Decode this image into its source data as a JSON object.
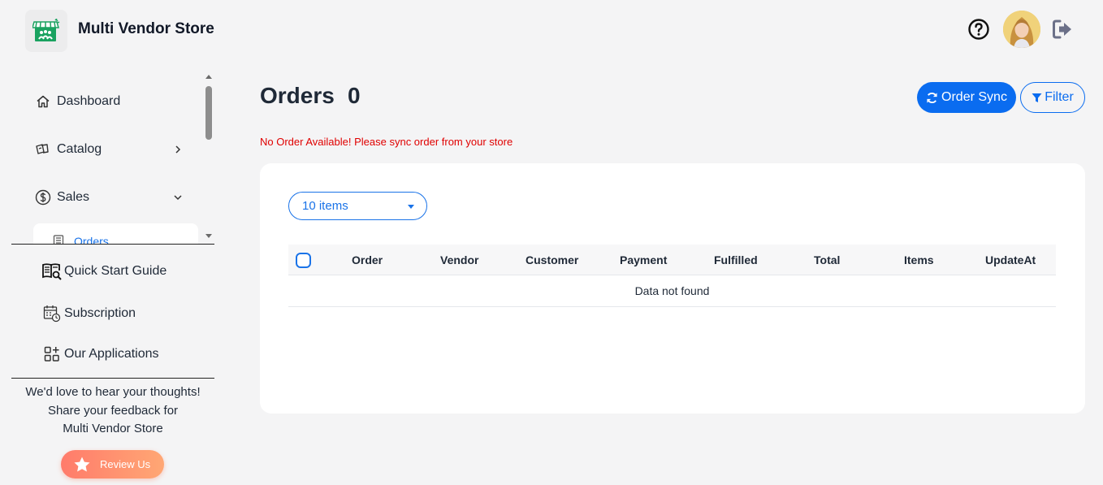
{
  "app": {
    "title": "Multi Vendor Store"
  },
  "header": {
    "help_icon": "question-circle-icon",
    "avatar": "user-avatar",
    "logout_icon": "logout-icon"
  },
  "sidebar": {
    "items": [
      {
        "label": "Dashboard",
        "icon": "home-icon"
      },
      {
        "label": "Catalog",
        "icon": "catalog-icon",
        "chevron": "chevron-right-icon"
      },
      {
        "label": "Sales",
        "icon": "dollar-circle-icon",
        "chevron": "chevron-down-icon"
      }
    ],
    "sub_items": [
      {
        "label": "Orders",
        "icon": "list-icon"
      }
    ],
    "extra": [
      {
        "label": "Quick Start Guide",
        "icon": "book-search-icon"
      },
      {
        "label": "Subscription",
        "icon": "calendar-clock-icon"
      },
      {
        "label": "Our Applications",
        "icon": "apps-grid-icon"
      }
    ],
    "feedback": {
      "line1": "We'd love to hear your thoughts!",
      "line2": "Share your feedback for",
      "line3": "Multi Vendor Store",
      "button": "Review Us"
    }
  },
  "main": {
    "title": "Orders",
    "count": "0",
    "alert": "No Order Available! Please sync order from your store",
    "sync_button": "Order Sync",
    "filter_button": "Filter",
    "page_size": "10 items",
    "columns": [
      "Order",
      "Vendor",
      "Customer",
      "Payment",
      "Fulfilled",
      "Total",
      "Items",
      "UpdateAt"
    ],
    "empty_text": "Data not found"
  },
  "colors": {
    "accent": "#0a6cf0",
    "alert": "#e00000",
    "review_from": "#ff7b6b",
    "review_to": "#ffa774"
  }
}
